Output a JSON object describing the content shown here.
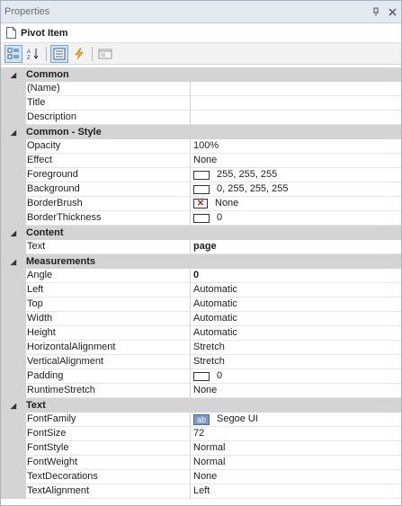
{
  "panel": {
    "title": "Properties",
    "pin_icon": "pin-icon",
    "close_icon": "close-icon"
  },
  "object": {
    "name": "Pivot Item",
    "icon": "document-icon"
  },
  "toolbar": {
    "buttons": [
      {
        "name": "categorized-button",
        "icon": "categorized-icon",
        "selected": true
      },
      {
        "name": "alphabetical-button",
        "icon": "sort-az-icon",
        "selected": false
      },
      {
        "name": "properties-button",
        "icon": "properties-list-icon",
        "selected": true
      },
      {
        "name": "events-button",
        "icon": "lightning-icon",
        "selected": false
      },
      {
        "name": "property-pages-button",
        "icon": "property-pages-icon",
        "selected": false
      }
    ]
  },
  "categories": [
    {
      "label": "Common",
      "expander": "◢",
      "rows": [
        {
          "name": "(Name)",
          "value": ""
        },
        {
          "name": "Title",
          "value": ""
        },
        {
          "name": "Description",
          "value": ""
        }
      ]
    },
    {
      "label": "Common - Style",
      "expander": "◢",
      "rows": [
        {
          "name": "Opacity",
          "value": "100%"
        },
        {
          "name": "Effect",
          "value": "None"
        },
        {
          "name": "Foreground",
          "value": "255, 255, 255",
          "widget": "swatch",
          "color": "#ffffff"
        },
        {
          "name": "Background",
          "value": "0, 255, 255, 255",
          "widget": "swatch",
          "color": "#ffffff"
        },
        {
          "name": "BorderBrush",
          "value": "None",
          "widget": "xbox"
        },
        {
          "name": "BorderThickness",
          "value": "0",
          "widget": "swatch",
          "color": "#ffffff"
        }
      ]
    },
    {
      "label": "Content",
      "expander": "◢",
      "rows": [
        {
          "name": "Text",
          "value": "page",
          "bold": true
        }
      ]
    },
    {
      "label": "Measurements",
      "expander": "◢",
      "rows": [
        {
          "name": "Angle",
          "value": "0",
          "bold": true
        },
        {
          "name": "Left",
          "value": "Automatic"
        },
        {
          "name": "Top",
          "value": "Automatic"
        },
        {
          "name": "Width",
          "value": "Automatic"
        },
        {
          "name": "Height",
          "value": "Automatic"
        },
        {
          "name": "HorizontalAlignment",
          "value": "Stretch"
        },
        {
          "name": "VerticalAlignment",
          "value": "Stretch"
        },
        {
          "name": "Padding",
          "value": "0",
          "widget": "swatch",
          "color": "#ffffff"
        },
        {
          "name": "RuntimeStretch",
          "value": "None"
        }
      ]
    },
    {
      "label": "Text",
      "expander": "◢",
      "rows": [
        {
          "name": "FontFamily",
          "value": "Segoe UI",
          "widget": "font",
          "glyph": "ab"
        },
        {
          "name": "FontSize",
          "value": "72"
        },
        {
          "name": "FontStyle",
          "value": "Normal"
        },
        {
          "name": "FontWeight",
          "value": "Normal"
        },
        {
          "name": "TextDecorations",
          "value": "None"
        },
        {
          "name": "TextAlignment",
          "value": "Left"
        }
      ]
    }
  ]
}
